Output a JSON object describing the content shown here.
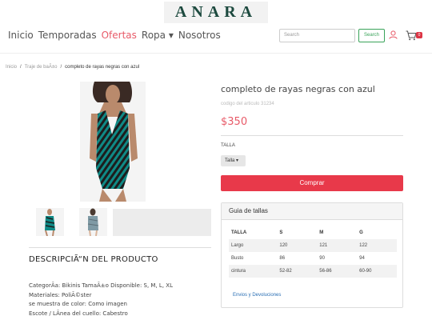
{
  "brand": {
    "logo_text": "ANARA"
  },
  "nav": {
    "items": [
      "Inicio",
      "Temporadas",
      "Ofertas",
      "Ropa ▾",
      "Nosotros"
    ],
    "active_index": 2
  },
  "search": {
    "placeholder": "Search",
    "button_label": "Search"
  },
  "cart": {
    "count": "0"
  },
  "breadcrumb": {
    "items": [
      "Inicio",
      "Traje de baÃ±o"
    ],
    "current": "completo de rayas negras con azul"
  },
  "product": {
    "title": "completo de rayas negras con azul",
    "code": "codigo del articulo 31234",
    "price": "$350",
    "size_label": "TALLA",
    "size_selected": "Talla ▾",
    "buy_label": "Comprar"
  },
  "description": {
    "title": "DESCRIPCIÃ“N DEL PRODUCTO",
    "lines": [
      "CategorÃ­a: Bikinis TamaÃ±o Disponible: S, M, L, XL",
      "Materiales: PoliÃ©ster",
      "se muestra de color: Como imagen",
      "Escote / LÃ­nea del cuello: Cabestro"
    ]
  },
  "size_guide": {
    "title": "Guia de tallas",
    "headers": [
      "TALLA",
      "S",
      "M",
      "G"
    ],
    "rows": [
      [
        "Largo",
        "120",
        "121",
        "122"
      ],
      [
        "Busto",
        "86",
        "90",
        "94"
      ],
      [
        "cintura",
        "52-82",
        "56-86",
        "60-90"
      ]
    ],
    "link_label": "Envios y Devoluciones"
  },
  "colors": {
    "accent": "#e85a68",
    "buy": "#e8394a",
    "brand": "#1d4a3f",
    "search": "#3aa35a"
  }
}
